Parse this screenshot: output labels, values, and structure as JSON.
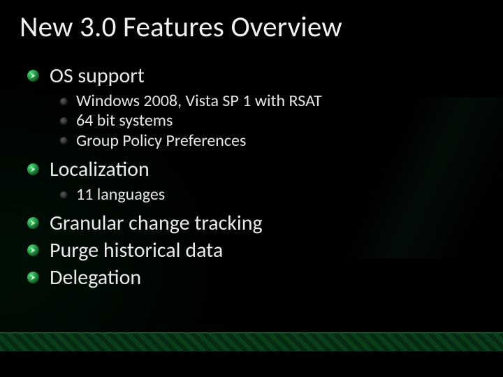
{
  "title": "New 3.0 Features Overview",
  "items": [
    {
      "label": "OS support",
      "children": [
        "Windows 2008, Vista SP 1 with RSAT",
        "64 bit systems",
        "Group Policy Preferences"
      ]
    },
    {
      "label": "Localization",
      "children": [
        "11 languages"
      ]
    },
    {
      "label": "Granular change tracking"
    },
    {
      "label": "Purge historical data"
    },
    {
      "label": "Delegation"
    }
  ]
}
